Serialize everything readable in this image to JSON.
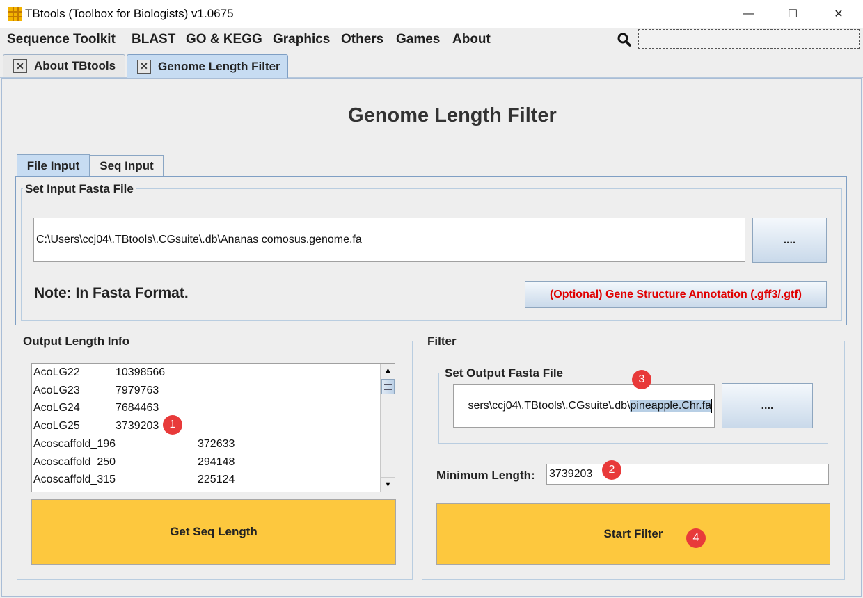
{
  "window": {
    "title": "TBtools (Toolbox for Biologists) v1.0675",
    "minimize": "—",
    "maximize": "☐",
    "close": "✕"
  },
  "menu": [
    "Sequence Toolkit",
    "BLAST",
    "GO & KEGG",
    "Graphics",
    "Others",
    "Games",
    "About"
  ],
  "tabs": [
    {
      "label": "About TBtools",
      "active": false
    },
    {
      "label": "Genome Length Filter",
      "active": true
    }
  ],
  "page_title": "Genome Length Filter",
  "input_tabs": [
    "File Input",
    "Seq Input"
  ],
  "input_group": {
    "title": "Set Input Fasta File",
    "path": "C:\\Users\\ccj04\\.TBtools\\.CGsuite\\.db\\Ananas comosus.genome.fa",
    "browse": "....",
    "note": "Note: In Fasta Format.",
    "gff_button": "(Optional) Gene Structure Annotation (.gff3/.gtf)"
  },
  "output_info": {
    "title": "Output Length Info",
    "rows": [
      {
        "name": "AcoLG22",
        "length": "10398566"
      },
      {
        "name": "AcoLG23",
        "length": "7979763"
      },
      {
        "name": "AcoLG24",
        "length": "7684463"
      },
      {
        "name": "AcoLG25",
        "length": "3739203"
      },
      {
        "name": "Acoscaffold_196",
        "length": "372633"
      },
      {
        "name": "Acoscaffold_250",
        "length": "294148"
      },
      {
        "name": "Acoscaffold_315",
        "length": "225124"
      }
    ],
    "button": "Get Seq Length"
  },
  "filter": {
    "title": "Filter",
    "output_group_title": "Set Output Fasta File",
    "output_path_prefix": "sers\\ccj04\\.TBtools\\.CGsuite\\.db\\",
    "output_path_selected": "pineapple.Chr.fa",
    "browse": "....",
    "min_length_label": "Minimum Length:",
    "min_length_value": "3739203",
    "button": "Start Filter"
  },
  "badges": [
    "1",
    "2",
    "3",
    "4"
  ],
  "colors": {
    "action_button": "#fdc83e",
    "badge": "#e83a3a",
    "gff_text": "#e00000",
    "selection": "#b8cfe5"
  }
}
